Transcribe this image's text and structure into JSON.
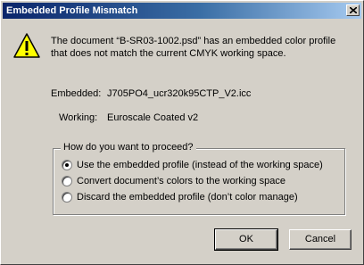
{
  "dialog": {
    "title": "Embedded Profile Mismatch",
    "message": "The document “B-SR03-1002.psd” has an embedded color profile that does not match the current CMYK working space.",
    "embedded_label": "Embedded:",
    "embedded_value": "J705PO4_ucr320k95CTP_V2.icc",
    "working_label": "Working:",
    "working_value": "Euroscale Coated v2",
    "group_label": "How do you want to proceed?",
    "options": [
      {
        "label": "Use the embedded profile (instead of the working space)",
        "selected": true
      },
      {
        "label": "Convert document’s colors to the working space",
        "selected": false
      },
      {
        "label": "Discard the embedded profile (don’t color manage)",
        "selected": false
      }
    ],
    "ok_label": "OK",
    "cancel_label": "Cancel"
  },
  "icons": {
    "close": "close-icon",
    "warning": "warning-icon"
  },
  "colors": {
    "title_start": "#0a246a",
    "title_end": "#a6caf0",
    "warning_fill": "#ffff00"
  }
}
